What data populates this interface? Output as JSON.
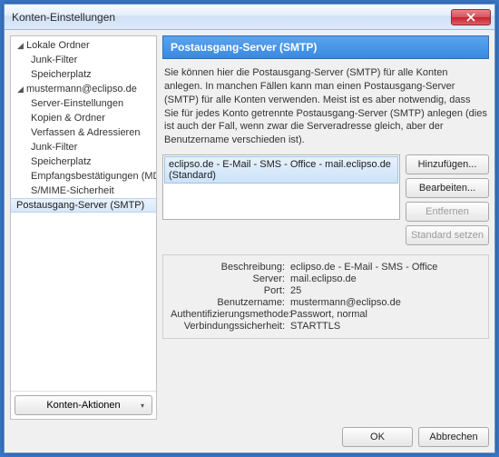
{
  "window": {
    "title": "Konten-Einstellungen"
  },
  "sidebar": {
    "items": [
      {
        "label": "Lokale Ordner",
        "type": "parent"
      },
      {
        "label": "Junk-Filter",
        "type": "child"
      },
      {
        "label": "Speicherplatz",
        "type": "child"
      },
      {
        "label": "mustermann@eclipso.de",
        "type": "parent"
      },
      {
        "label": "Server-Einstellungen",
        "type": "child"
      },
      {
        "label": "Kopien & Ordner",
        "type": "child"
      },
      {
        "label": "Verfassen & Adressieren",
        "type": "child"
      },
      {
        "label": "Junk-Filter",
        "type": "child"
      },
      {
        "label": "Speicherplatz",
        "type": "child"
      },
      {
        "label": "Empfangsbestätigungen (MDN)",
        "type": "child"
      },
      {
        "label": "S/MIME-Sicherheit",
        "type": "child"
      },
      {
        "label": "Postausgang-Server (SMTP)",
        "type": "selected"
      }
    ],
    "actions_label": "Konten-Aktionen"
  },
  "panel": {
    "title": "Postausgang-Server (SMTP)",
    "description": "Sie können hier die Postausgang-Server (SMTP) für alle Konten anlegen. In manchen Fällen kann man einen Postausgang-Server (SMTP) für alle Konten verwenden. Meist ist es aber notwendig, dass Sie für jedes Konto getrennte Postausgang-Server (SMTP) anlegen (dies ist auch der Fall, wenn zwar die Serveradresse gleich, aber der Benutzername verschieden ist).",
    "list": {
      "items": [
        "eclipso.de - E-Mail - SMS - Office - mail.eclipso.de (Standard)"
      ]
    },
    "buttons": {
      "add": "Hinzufügen...",
      "edit": "Bearbeiten...",
      "remove": "Entfernen",
      "default": "Standard setzen"
    },
    "details": {
      "labels": {
        "desc": "Beschreibung:",
        "server": "Server:",
        "port": "Port:",
        "user": "Benutzername:",
        "auth": "Authentifizierungsmethode:",
        "sec": "Verbindungssicherheit:"
      },
      "values": {
        "desc": "eclipso.de - E-Mail - SMS - Office",
        "server": "mail.eclipso.de",
        "port": "25",
        "user": "mustermann@eclipso.de",
        "auth": "Passwort, normal",
        "sec": "STARTTLS"
      }
    }
  },
  "footer": {
    "ok": "OK",
    "cancel": "Abbrechen"
  }
}
